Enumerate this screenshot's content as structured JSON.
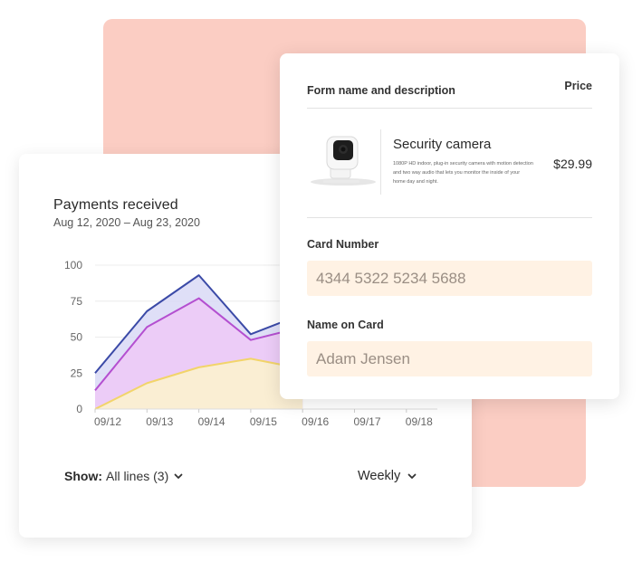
{
  "chart_card": {
    "title": "Payments received",
    "subtitle": "Aug 12, 2020 – Aug 23, 2020",
    "show_label": "Show:",
    "show_value": "All lines (3)",
    "period": "Weekly"
  },
  "chart_data": {
    "type": "area",
    "categories": [
      "09/12",
      "09/13",
      "09/14",
      "09/15",
      "09/16",
      "09/17",
      "09/18"
    ],
    "ylim": [
      0,
      100
    ],
    "yticks": [
      0,
      25,
      50,
      75,
      100
    ],
    "grid": true,
    "series": [
      {
        "color": "#3b4aa7",
        "fill": "#d9d9f6",
        "values": [
          25,
          68,
          93,
          52,
          66,
          null,
          null
        ]
      },
      {
        "color": "#b44fd0",
        "fill": "#efc9f7",
        "values": [
          13,
          57,
          77,
          48,
          57,
          null,
          null
        ]
      },
      {
        "color": "#f2d46a",
        "fill": "#fdf3cc",
        "values": [
          0,
          18,
          29,
          35,
          28,
          null,
          null
        ]
      }
    ]
  },
  "form_card": {
    "header": "Form name and description",
    "price_header": "Price",
    "product": {
      "name": "Security camera",
      "description": "1080P HD indoor, plug-in security camera with motion detection and two way audio that lets you monitor the inside of your home day and night.",
      "price": "$29.99"
    },
    "card_number_label": "Card Number",
    "card_number_value": "4344 5322 5234 5688",
    "name_label": "Name on Card",
    "name_value": "Adam Jensen"
  },
  "colors": {
    "background_panel": "#fbcdc3",
    "input_fill": "#fff2e4"
  }
}
